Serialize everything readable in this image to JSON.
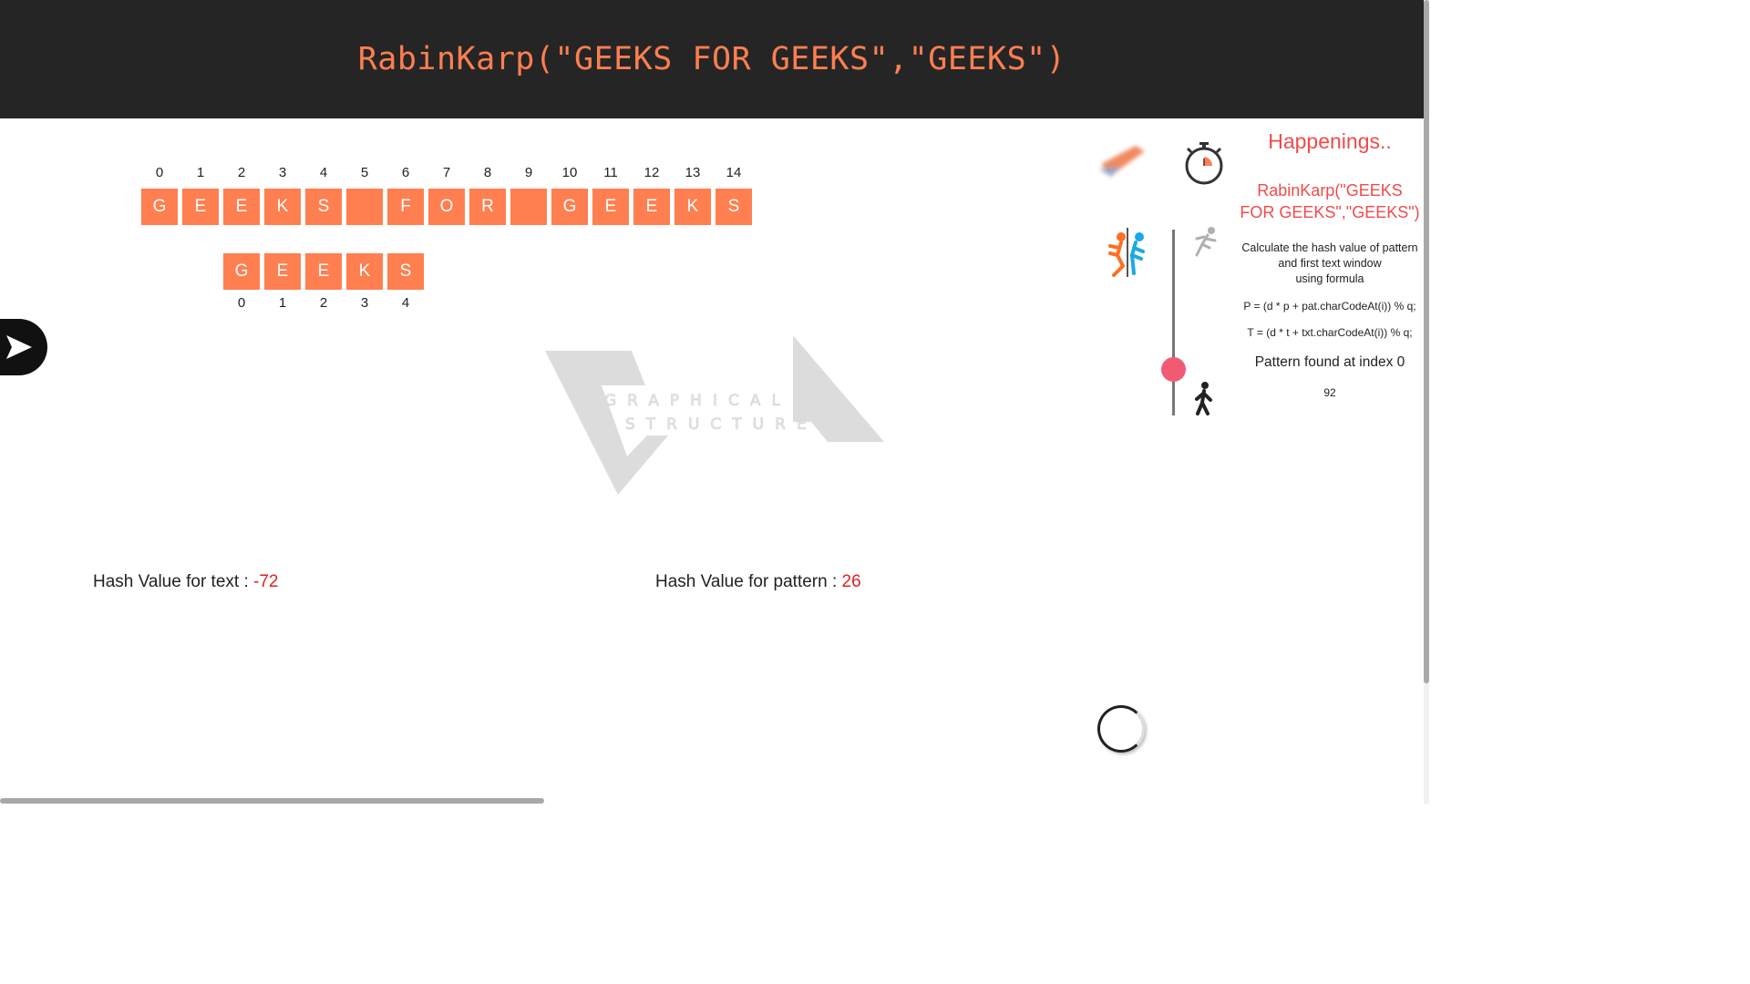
{
  "header": {
    "title": "RabinKarp(\"GEEKS FOR GEEKS\",\"GEEKS\")"
  },
  "text_array": {
    "indices": [
      "0",
      "1",
      "2",
      "3",
      "4",
      "5",
      "6",
      "7",
      "8",
      "9",
      "10",
      "11",
      "12",
      "13",
      "14"
    ],
    "chars": [
      "G",
      "E",
      "E",
      "K",
      "S",
      " ",
      "F",
      "O",
      "R",
      " ",
      "G",
      "E",
      "E",
      "K",
      "S"
    ]
  },
  "pattern_array": {
    "chars": [
      "G",
      "E",
      "E",
      "K",
      "S"
    ],
    "indices": [
      "0",
      "1",
      "2",
      "3",
      "4"
    ]
  },
  "watermark": {
    "line1": "GRAPHICAL",
    "line2": "STRUCTURE"
  },
  "hash_text": {
    "label": "Hash Value for text : ",
    "value": "-72"
  },
  "hash_pattern": {
    "label": "Hash Value for pattern : ",
    "value": "26"
  },
  "sidebar": {
    "title": "Happenings..",
    "call": "RabinKarp(\"GEEKS FOR GEEKS\",\"GEEKS\")",
    "desc_line1": "Calculate the hash value of pattern",
    "desc_line2": "and first text window",
    "desc_line3": "using formula",
    "formula_p": "P = (d * p + pat.charCodeAt(i)) % q;",
    "formula_t": "T = (d * t + txt.charCodeAt(i)) % q;",
    "result": "Pattern found at index 0",
    "speed_value": "92"
  },
  "speed": {
    "level_fraction": 0.25
  },
  "colors": {
    "cell": "#ff7f50",
    "accent": "#ef4b4b",
    "hash_value": "#e02020",
    "knob": "#f25a74"
  },
  "icons": [
    "play-icon",
    "eraser-icon",
    "stopwatch-icon",
    "portal-icon",
    "running-man-icon",
    "walking-man-icon",
    "loading-spinner-icon"
  ]
}
